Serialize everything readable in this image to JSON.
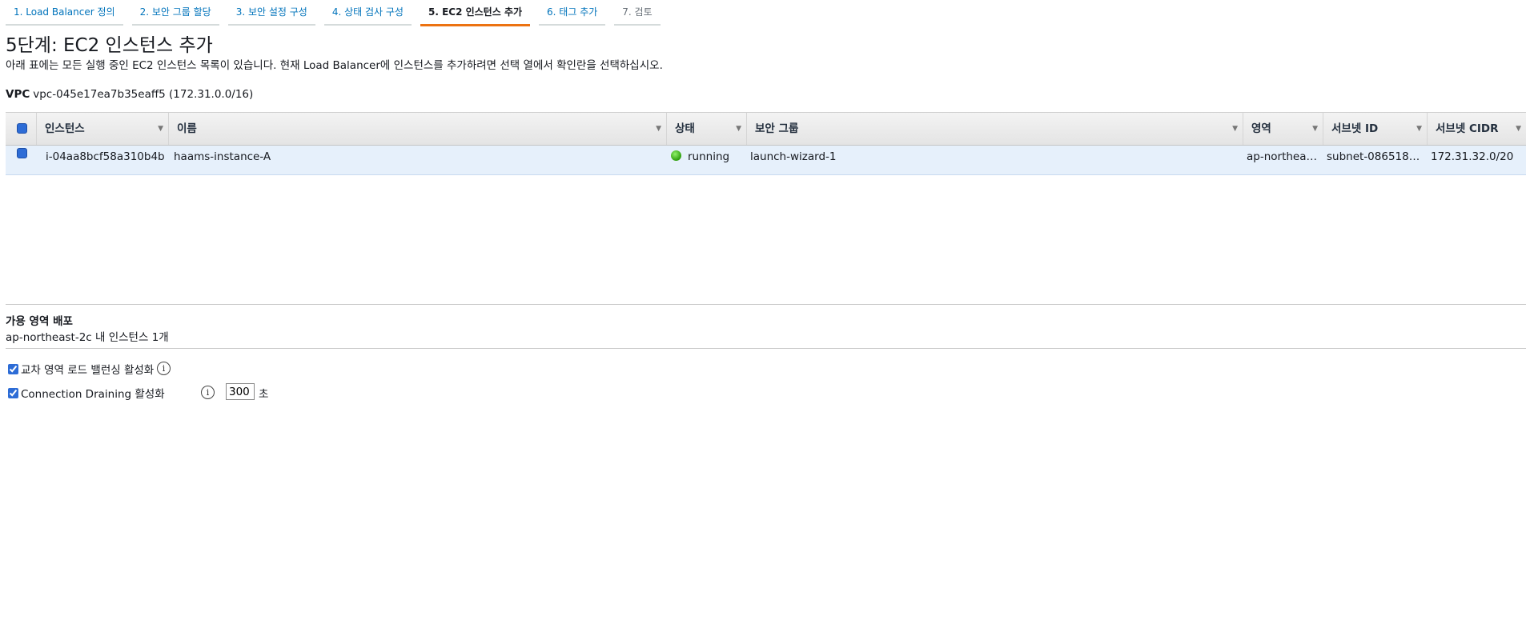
{
  "wizard": {
    "tabs": [
      {
        "label": "1. Load Balancer 정의",
        "state": "link"
      },
      {
        "label": "2. 보안 그룹 할당",
        "state": "link"
      },
      {
        "label": "3. 보안 설정 구성",
        "state": "link"
      },
      {
        "label": "4. 상태 검사 구성",
        "state": "link"
      },
      {
        "label": "5. EC2 인스턴스 추가",
        "state": "active"
      },
      {
        "label": "6. 태그 추가",
        "state": "link"
      },
      {
        "label": "7. 검토",
        "state": "disabled"
      }
    ],
    "accent_color": "#ec7211"
  },
  "page": {
    "title": "5단계: EC2 인스턴스 추가",
    "description": "아래 표에는 모든 실행 중인 EC2 인스턴스 목록이 있습니다. 현재 Load Balancer에 인스턴스를 추가하려면 선택 열에서 확인란을 선택하십시오."
  },
  "vpc": {
    "label": "VPC",
    "value": "vpc-045e17ea7b35eaff5 (172.31.0.0/16)"
  },
  "table": {
    "columns": [
      "인스턴스",
      "이름",
      "상태",
      "보안 그룹",
      "영역",
      "서브넷 ID",
      "서브넷 CIDR"
    ],
    "rows": [
      {
        "selected": true,
        "instance": "i-04aa8bcf58a310b4b",
        "name": "haams-instance-A",
        "state": "running",
        "state_icon": "green-dot-icon",
        "security_group": "launch-wizard-1",
        "zone": "ap-northea…",
        "subnet_id": "subnet-0865182…",
        "subnet_cidr": "172.31.32.0/20"
      }
    ]
  },
  "availability": {
    "title": "가용 영역 배포",
    "text": "ap-northeast-2c 내 인스턴스 1개"
  },
  "options": {
    "cross_zone": {
      "label": "교차 영역 로드 밸런싱 활성화",
      "checked": true
    },
    "connection_draining": {
      "label": "Connection Draining 활성화",
      "checked": true,
      "timeout": "300",
      "unit": "초"
    }
  }
}
